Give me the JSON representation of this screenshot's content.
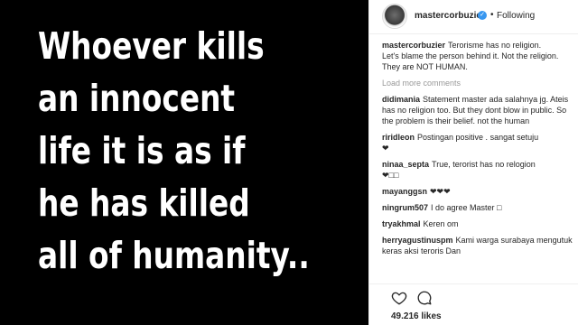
{
  "post": {
    "quote_lines": [
      "Whoever kills",
      "an innocent",
      "life it is as if",
      "he has killed",
      "all of humanity.."
    ]
  },
  "header": {
    "username": "mastercorbuzier",
    "verified_mark": "✓",
    "separator": "•",
    "follow_label": "Following"
  },
  "caption": {
    "username": "mastercorbuzier",
    "lines": [
      "Terorisme has no religion.",
      "Let's blame the person behind it. Not the religion.",
      "They are NOT HUMAN."
    ]
  },
  "load_more": "Load more comments",
  "comments": [
    {
      "username": "didimania",
      "text": "Statement master ada salahnya jg. Ateis has no religion too. But they dont blow in public. So the problem is their belief. not the human"
    },
    {
      "username": "riridleon",
      "text": "Postingan positive . sangat setuju",
      "extra": "❤"
    },
    {
      "username": "ninaa_septa",
      "text": "True, terorist has no relogion",
      "extra": "❤□□"
    },
    {
      "username": "mayanggsn",
      "text": "❤❤❤"
    },
    {
      "username": "ningrum507",
      "text": "I do agree Master □"
    },
    {
      "username": "tryakhmal",
      "text": "Keren om"
    },
    {
      "username": "herryagustinuspm",
      "text": "Kami warga surabaya mengutuk keras aksi teroris Dan"
    }
  ],
  "likes": "49.216 likes",
  "icons": {
    "heart": "heart-icon",
    "comment": "comment-icon"
  },
  "colors": {
    "image_bg": "#000000",
    "verified": "#3897f0",
    "muted": "#999999"
  }
}
